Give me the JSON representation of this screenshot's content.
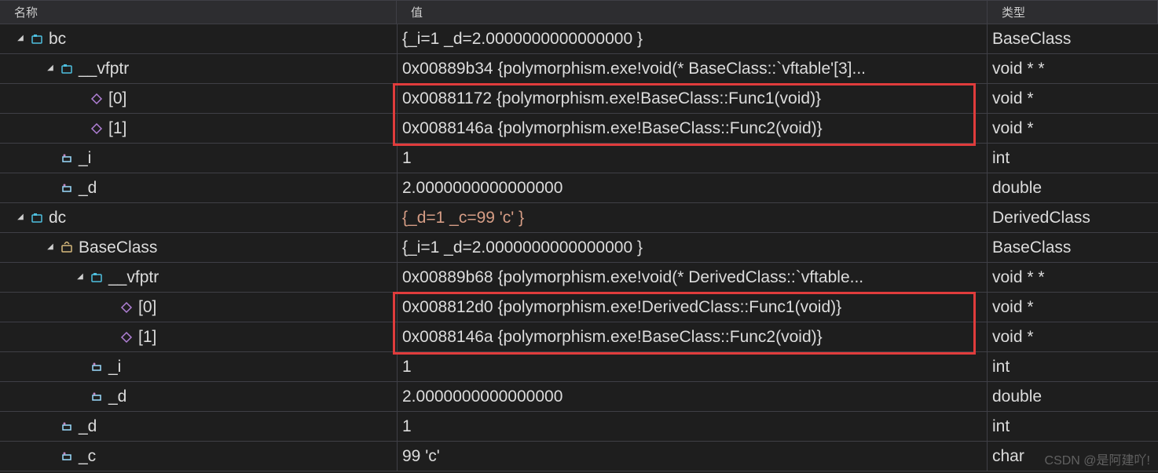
{
  "headers": {
    "name": "名称",
    "value": "值",
    "type": "类型"
  },
  "rows": [
    {
      "indent": 12,
      "arrow": "down",
      "icon": "class",
      "name": "bc",
      "value": "{_i=1 _d=2.0000000000000000 }",
      "type": "BaseClass"
    },
    {
      "indent": 50,
      "arrow": "down",
      "icon": "class",
      "name": "__vfptr",
      "value": "0x00889b34 {polymorphism.exe!void(* BaseClass::`vftable'[3]...",
      "type": "void * *"
    },
    {
      "indent": 88,
      "arrow": "none",
      "icon": "member",
      "name": "[0]",
      "value": "0x00881172 {polymorphism.exe!BaseClass::Func1(void)}",
      "type": "void *"
    },
    {
      "indent": 88,
      "arrow": "none",
      "icon": "member",
      "name": "[1]",
      "value": "0x0088146a {polymorphism.exe!BaseClass::Func2(void)}",
      "type": "void *"
    },
    {
      "indent": 50,
      "arrow": "none",
      "icon": "field",
      "name": "_i",
      "value": "1",
      "type": "int"
    },
    {
      "indent": 50,
      "arrow": "none",
      "icon": "field",
      "name": "_d",
      "value": "2.0000000000000000",
      "type": "double"
    },
    {
      "indent": 12,
      "arrow": "down",
      "icon": "class",
      "name": "dc",
      "value": "{_d=1 _c=99 'c' }",
      "type": "DerivedClass",
      "highlight": true
    },
    {
      "indent": 50,
      "arrow": "down",
      "icon": "base",
      "name": "BaseClass",
      "value": "{_i=1 _d=2.0000000000000000 }",
      "type": "BaseClass"
    },
    {
      "indent": 88,
      "arrow": "down",
      "icon": "class",
      "name": "__vfptr",
      "value": "0x00889b68 {polymorphism.exe!void(* DerivedClass::`vftable...",
      "type": "void * *"
    },
    {
      "indent": 126,
      "arrow": "none",
      "icon": "member",
      "name": "[0]",
      "value": "0x008812d0 {polymorphism.exe!DerivedClass::Func1(void)}",
      "type": "void *"
    },
    {
      "indent": 126,
      "arrow": "none",
      "icon": "member",
      "name": "[1]",
      "value": "0x0088146a {polymorphism.exe!BaseClass::Func2(void)}",
      "type": "void *"
    },
    {
      "indent": 88,
      "arrow": "none",
      "icon": "field",
      "name": "_i",
      "value": "1",
      "type": "int"
    },
    {
      "indent": 88,
      "arrow": "none",
      "icon": "field",
      "name": "_d",
      "value": "2.0000000000000000",
      "type": "double"
    },
    {
      "indent": 50,
      "arrow": "none",
      "icon": "field",
      "name": "_d",
      "value": "1",
      "type": "int"
    },
    {
      "indent": 50,
      "arrow": "none",
      "icon": "field",
      "name": "_c",
      "value": "99 'c'",
      "type": "char"
    }
  ],
  "watermark": "CSDN @是阿建吖!"
}
